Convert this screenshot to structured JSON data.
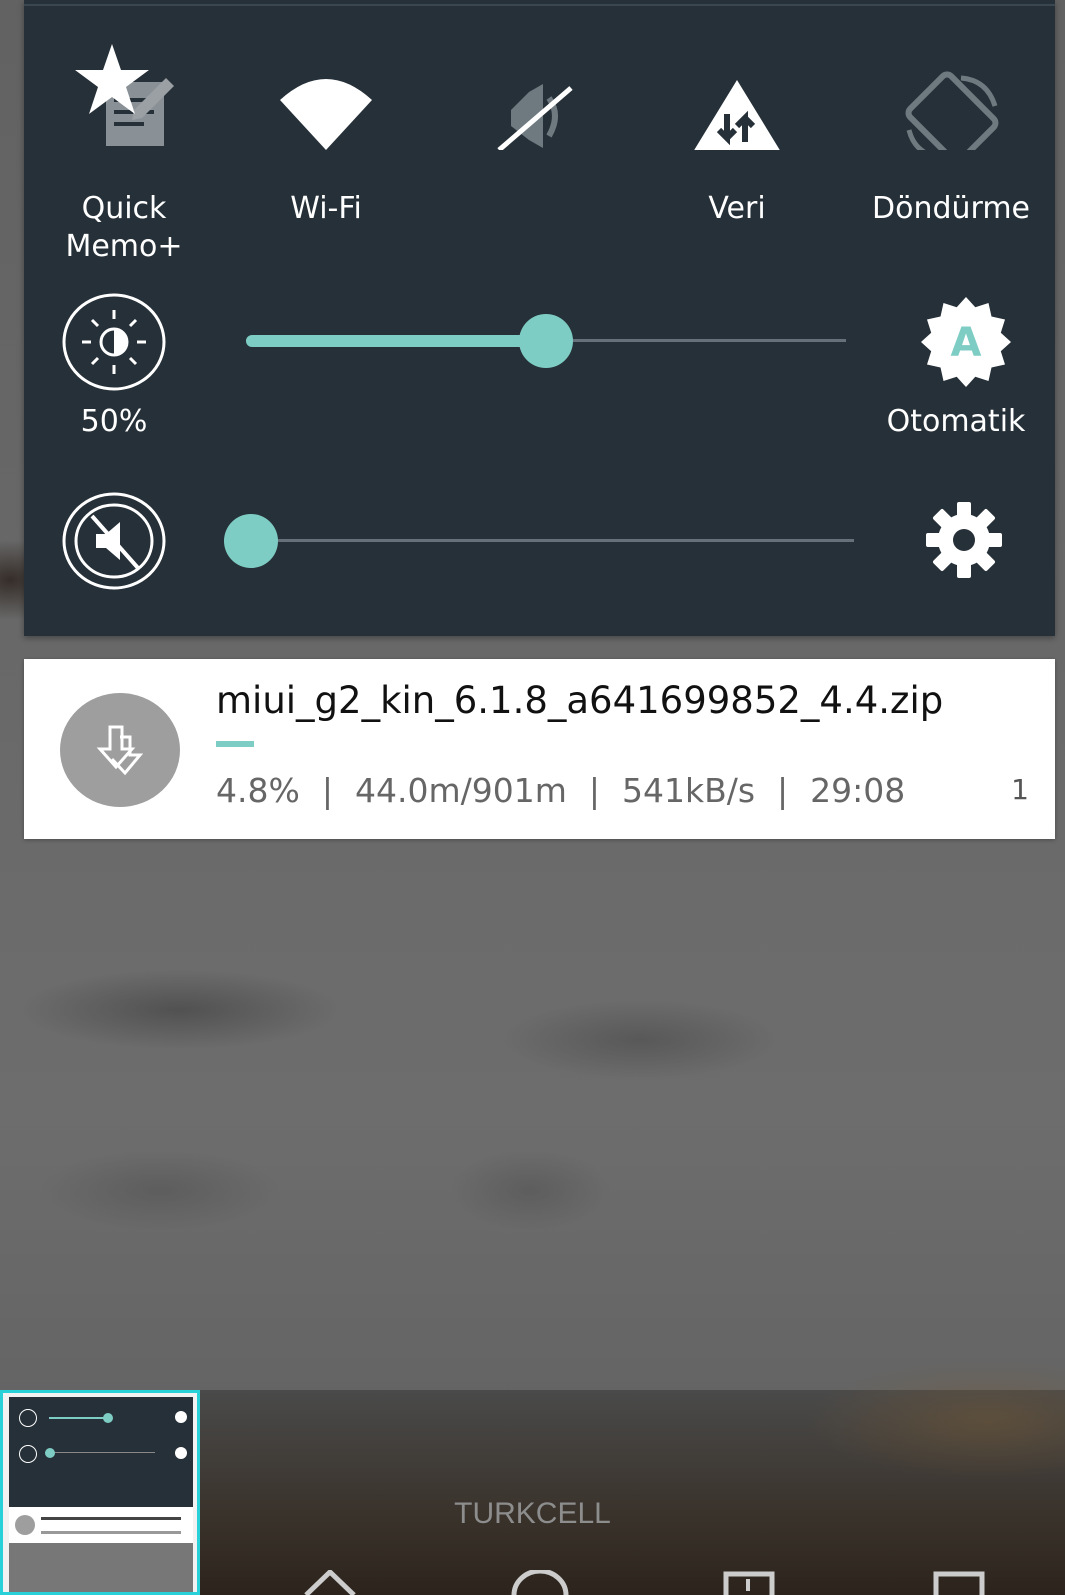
{
  "quick_settings": {
    "tiles": [
      {
        "name": "quick-memo",
        "label_line1": "Quick",
        "label_line2": "Memo+",
        "icon": "quick-memo-icon"
      },
      {
        "name": "wifi",
        "label_line1": "Wi-Fi",
        "label_line2": "",
        "icon": "wifi-icon"
      },
      {
        "name": "sound",
        "label_line1": "",
        "label_line2": "",
        "icon": "vibrate-off-icon"
      },
      {
        "name": "data",
        "label_line1": "Veri",
        "label_line2": "",
        "icon": "mobile-data-icon"
      },
      {
        "name": "rotation",
        "label_line1": "Döndürme",
        "label_line2": "",
        "icon": "screen-rotation-icon"
      }
    ],
    "brightness": {
      "value_label": "50%",
      "level": 0.5,
      "auto_label": "Otomatik"
    },
    "volume": {
      "level": 0.0
    },
    "accent_color": "#7ecdc4",
    "panel_color": "#263038"
  },
  "notification": {
    "filename": "miui_g2_kin_6.1.8_a641699852_4.4.zip",
    "progress_percent": 4.8,
    "percent_label": "4.8%",
    "size_label": "44.0m/901m",
    "speed_label": "541kB/s",
    "time_label": "29:08",
    "sep": "|",
    "count": "1"
  },
  "carrier": "TURKCELL"
}
